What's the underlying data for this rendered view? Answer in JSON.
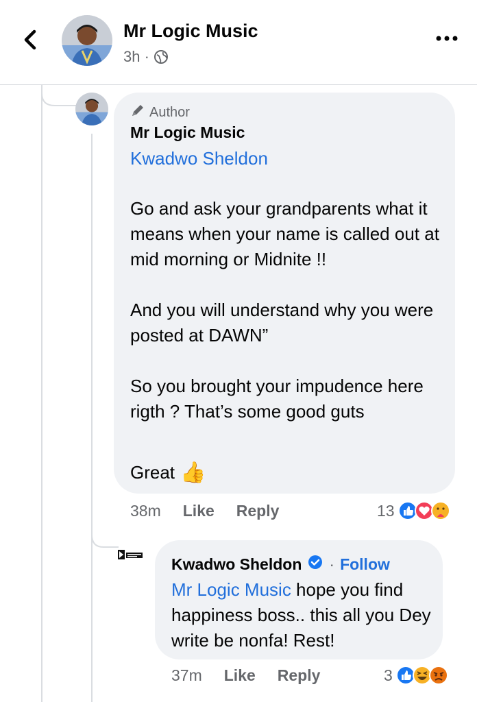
{
  "header": {
    "back_icon": "chevron-left-icon",
    "name": "Mr Logic Music",
    "time": "3h ·",
    "privacy_icon": "globe-icon",
    "more_icon": "more-horizontal-icon"
  },
  "comment1": {
    "author_tag": "Author",
    "author_icon": "pencil-icon",
    "name": "Mr Logic Music",
    "mention": "Kwadwo Sheldon",
    "text": "Go and ask your grandparents what it means when your name is called out at mid morning or Midnite !!\n\nAnd you will understand why you were posted at DAWN”\n\nSo you brought your impudence here rigth ? That’s some good guts",
    "closing": "Great",
    "closing_emoji": "👍",
    "time": "38m",
    "like": "Like",
    "reply": "Reply",
    "reaction_count": "13",
    "reactions": [
      "like-icon",
      "love-icon",
      "care-icon"
    ]
  },
  "comment2": {
    "name": "Kwadwo Sheldon",
    "verified_icon": "verified-badge-icon",
    "separator": "·",
    "follow": "Follow",
    "mention": "Mr Logic Music",
    "text": " hope you find happiness boss.. this all you Dey write be nonfa! Rest!",
    "time": "37m",
    "like": "Like",
    "reply": "Reply",
    "reaction_count": "3",
    "reactions": [
      "like-icon",
      "haha-icon",
      "angry-icon"
    ]
  },
  "colors": {
    "accent_blue": "#216fdb",
    "bubble_bg": "#f0f2f5",
    "muted_text": "#65676b"
  }
}
